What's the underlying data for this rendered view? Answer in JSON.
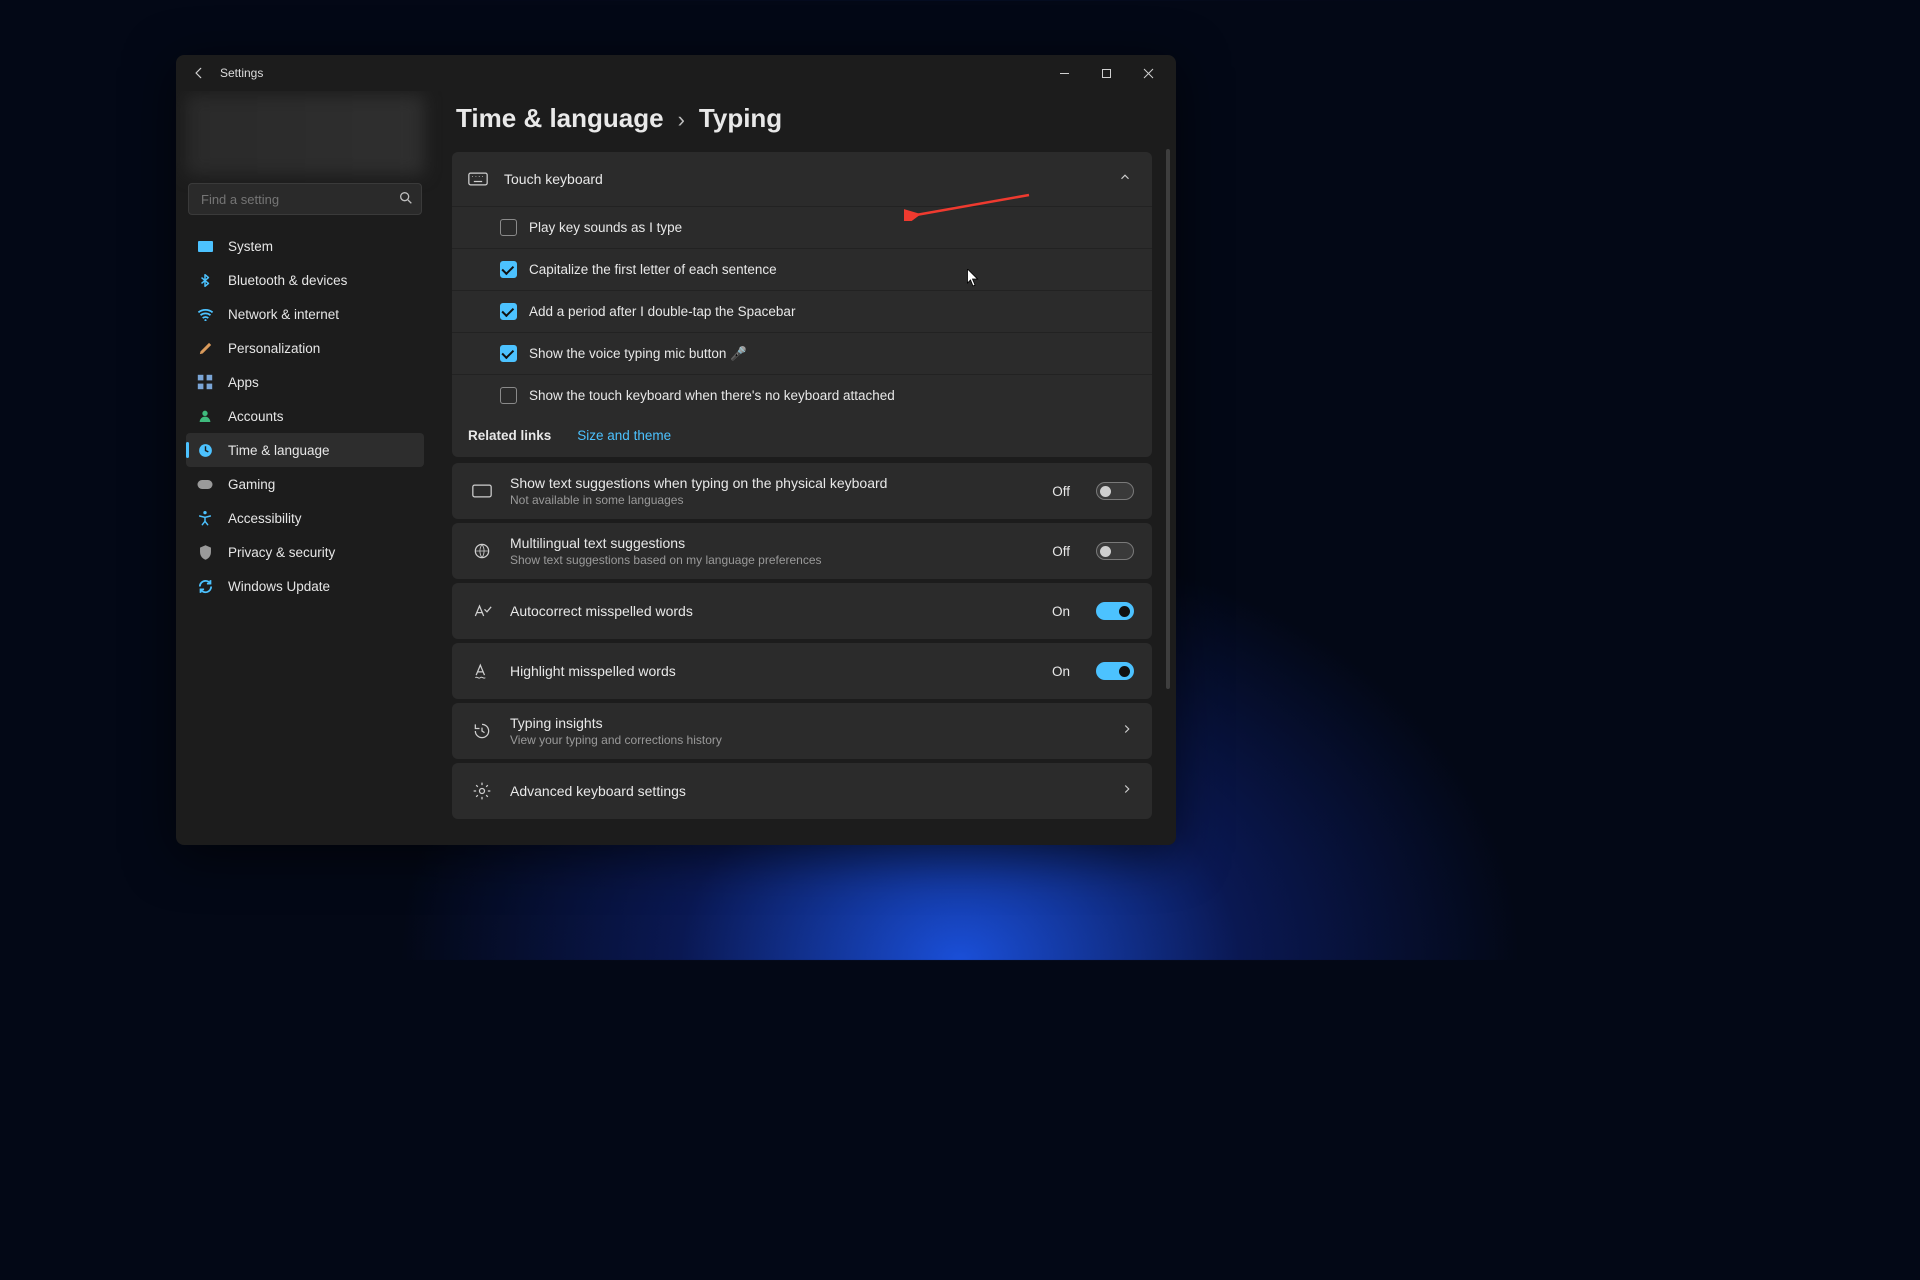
{
  "titlebar": {
    "title": "Settings"
  },
  "search": {
    "placeholder": "Find a setting"
  },
  "nav": [
    {
      "label": "System"
    },
    {
      "label": "Bluetooth & devices"
    },
    {
      "label": "Network & internet"
    },
    {
      "label": "Personalization"
    },
    {
      "label": "Apps"
    },
    {
      "label": "Accounts"
    },
    {
      "label": "Time & language"
    },
    {
      "label": "Gaming"
    },
    {
      "label": "Accessibility"
    },
    {
      "label": "Privacy & security"
    },
    {
      "label": "Windows Update"
    }
  ],
  "breadcrumb": {
    "parent": "Time & language",
    "sep": "›",
    "current": "Typing"
  },
  "touchkb": {
    "title": "Touch keyboard",
    "options": [
      {
        "label": "Play key sounds as I type",
        "checked": false
      },
      {
        "label": "Capitalize the first letter of each sentence",
        "checked": true
      },
      {
        "label": "Add a period after I double-tap the Spacebar",
        "checked": true
      },
      {
        "label": "Show the voice typing mic button 🎤",
        "checked": true
      },
      {
        "label": "Show the touch keyboard when there's no keyboard attached",
        "checked": false
      }
    ]
  },
  "related": {
    "label": "Related links",
    "link": "Size and theme"
  },
  "settings": [
    {
      "title": "Show text suggestions when typing on the physical keyboard",
      "sub": "Not available in some languages",
      "state": "Off",
      "on": false,
      "type": "toggle"
    },
    {
      "title": "Multilingual text suggestions",
      "sub": "Show text suggestions based on my language preferences",
      "state": "Off",
      "on": false,
      "type": "toggle"
    },
    {
      "title": "Autocorrect misspelled words",
      "sub": "",
      "state": "On",
      "on": true,
      "type": "toggle"
    },
    {
      "title": "Highlight misspelled words",
      "sub": "",
      "state": "On",
      "on": true,
      "type": "toggle"
    },
    {
      "title": "Typing insights",
      "sub": "View your typing and corrections history",
      "state": "",
      "on": false,
      "type": "link"
    },
    {
      "title": "Advanced keyboard settings",
      "sub": "",
      "state": "",
      "on": false,
      "type": "link"
    }
  ]
}
